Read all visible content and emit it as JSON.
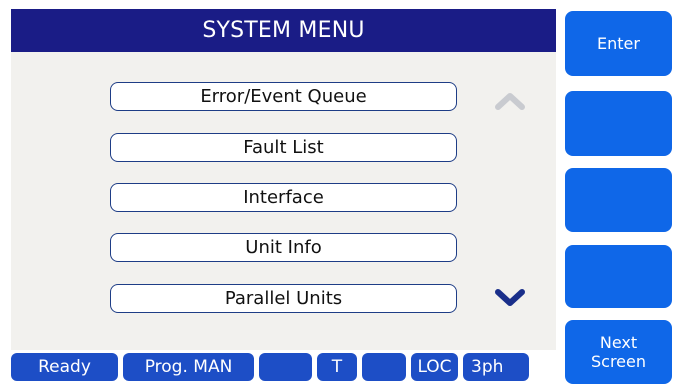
{
  "title": "SYSTEM MENU",
  "menu_items": [
    "Error/Event Queue",
    "Fault List",
    "Interface",
    "Unit Info",
    "Parallel Units"
  ],
  "side_buttons": {
    "enter": "Enter",
    "blank1": "",
    "blank2": "",
    "blank3": "",
    "next_line1": "Next",
    "next_line2": "Screen"
  },
  "status_bar": {
    "ready": "Ready",
    "prog": "Prog. MAN",
    "blank1": "",
    "t": "T",
    "blank2": "",
    "loc": "LOC",
    "phase": "3ph"
  },
  "colors": {
    "title_bar": "#1a1c86",
    "status_pill": "#1d4ec6",
    "side_button": "#0f67e8",
    "scroll_up_inactive": "#c9cbd0",
    "scroll_down_active": "#1a2f8a"
  },
  "icons": {
    "scroll_up": "chevron-up-icon",
    "scroll_down": "chevron-down-icon",
    "network": "network-icon"
  }
}
